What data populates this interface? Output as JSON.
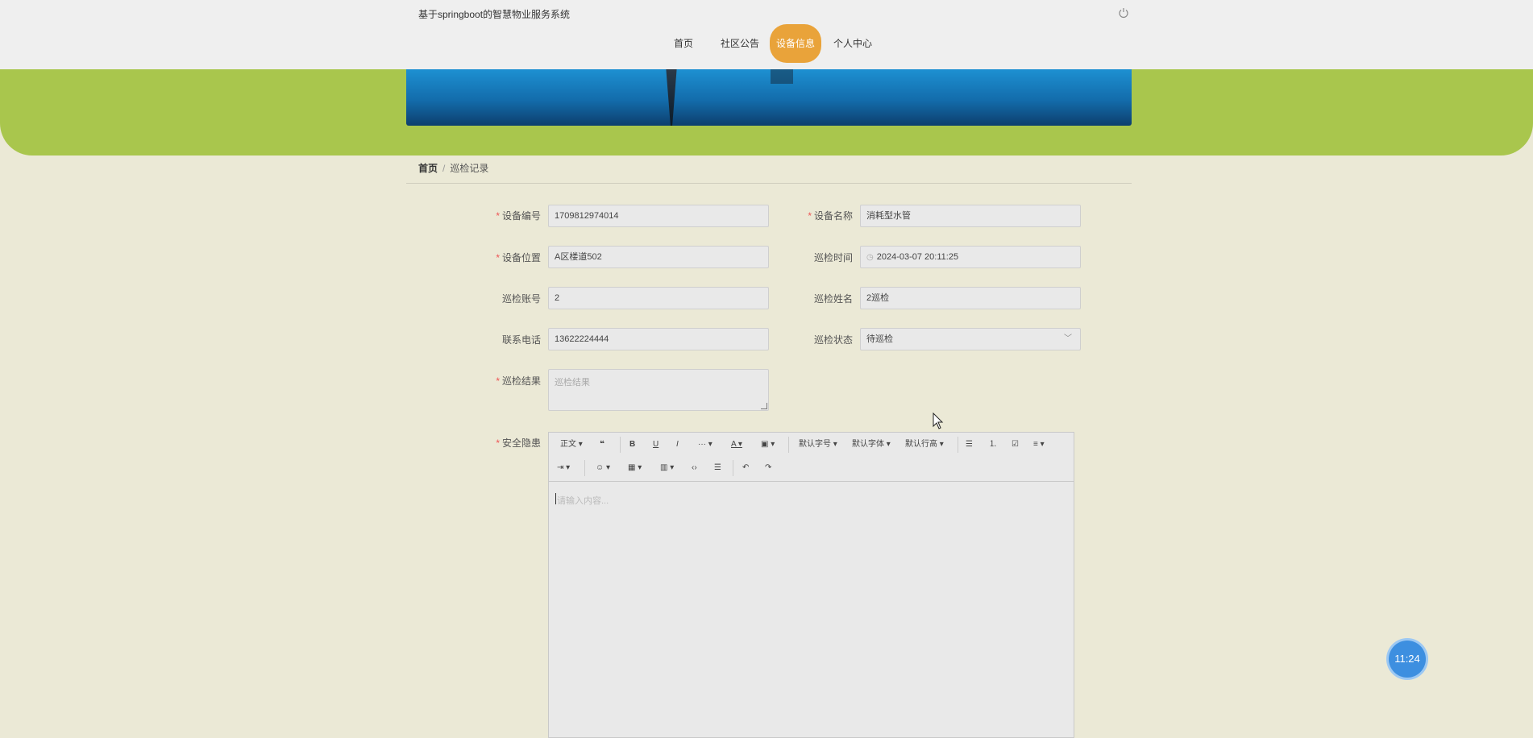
{
  "header": {
    "title": "基于springboot的智慧物业服务系统",
    "nav": [
      "首页",
      "社区公告",
      "设备信息",
      "个人中心"
    ],
    "active_index": 2
  },
  "breadcrumb": {
    "home": "首页",
    "separator": "/",
    "current": "巡检记录"
  },
  "form": {
    "device_no": {
      "label": "设备编号",
      "value": "1709812974014",
      "required": true
    },
    "device_name": {
      "label": "设备名称",
      "value": "消耗型水管",
      "required": true
    },
    "device_location": {
      "label": "设备位置",
      "value": "A区楼道502",
      "required": true
    },
    "inspect_time": {
      "label": "巡检时间",
      "value": "2024-03-07 20:11:25",
      "required": false
    },
    "inspect_account": {
      "label": "巡检账号",
      "value": "2",
      "required": false
    },
    "inspect_name": {
      "label": "巡检姓名",
      "value": "2巡检",
      "required": false
    },
    "phone": {
      "label": "联系电话",
      "value": "13622224444",
      "required": false
    },
    "inspect_status": {
      "label": "巡检状态",
      "value": "待巡检",
      "required": false
    },
    "inspect_result": {
      "label": "巡检结果",
      "placeholder": "巡检结果",
      "required": true
    },
    "safety_hazard": {
      "label": "安全隐患",
      "placeholder": "请输入内容...",
      "required": true
    }
  },
  "editor_toolbar": {
    "heading": "正文",
    "font_size": "默认字号",
    "font_family": "默认字体",
    "line_height": "默认行高"
  },
  "float_clock": "11:24"
}
